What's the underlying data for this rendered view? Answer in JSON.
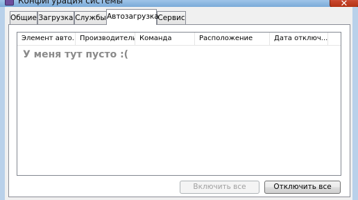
{
  "window": {
    "title": "Конфигурация системы",
    "close_label": "✕"
  },
  "tabs": [
    {
      "label": "Общие",
      "active": false
    },
    {
      "label": "Загрузка",
      "active": false
    },
    {
      "label": "Службы",
      "active": false
    },
    {
      "label": "Автозагрузка",
      "active": true
    },
    {
      "label": "Сервис",
      "active": false
    }
  ],
  "startup_list": {
    "columns": [
      "Элемент авто...",
      "Производитель",
      "Команда",
      "Расположение",
      "Дата отключ..."
    ],
    "rows": [],
    "empty_message": "У меня тут пусто :("
  },
  "buttons": {
    "enable_all": "Включить все",
    "disable_all": "Отключить все"
  }
}
